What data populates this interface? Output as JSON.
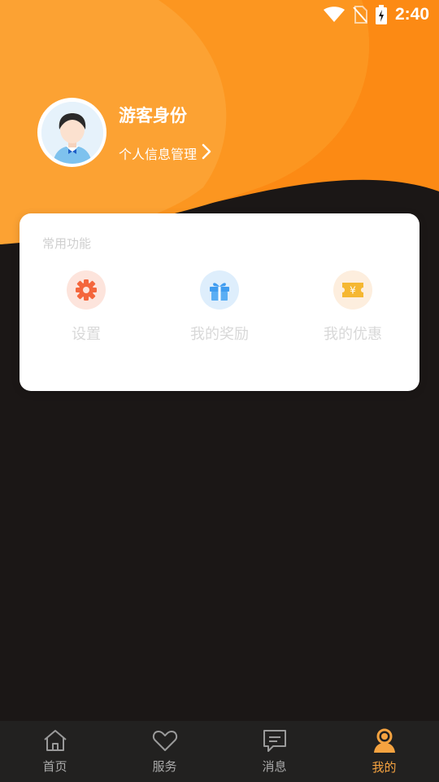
{
  "status_bar": {
    "time": "2:40",
    "icons": [
      "wifi-icon",
      "no-sim-icon",
      "battery-charging-icon"
    ]
  },
  "profile": {
    "name": "游客身份",
    "link_label": "个人信息管理",
    "avatar_icon": "avatar-boy-icon"
  },
  "functions": {
    "title": "常用功能",
    "items": [
      {
        "label": "设置",
        "icon": "gear-icon",
        "color": "#f4663c"
      },
      {
        "label": "我的奖励",
        "icon": "gift-icon",
        "color": "#3f9cf0"
      },
      {
        "label": "我的优惠",
        "icon": "coupon-icon",
        "color": "#f5b732"
      }
    ]
  },
  "tabbar": {
    "tabs": [
      {
        "label": "首页",
        "icon": "home-icon",
        "active": false
      },
      {
        "label": "服务",
        "icon": "heart-icon",
        "active": false
      },
      {
        "label": "消息",
        "icon": "message-icon",
        "active": false
      },
      {
        "label": "我的",
        "icon": "person-icon",
        "active": true
      }
    ],
    "active_color": "#f5a340",
    "inactive_color": "#aaaaaa"
  },
  "colors": {
    "header_orange": "#fb8a17",
    "header_light": "#fca230",
    "background_dark": "#1b1716"
  }
}
